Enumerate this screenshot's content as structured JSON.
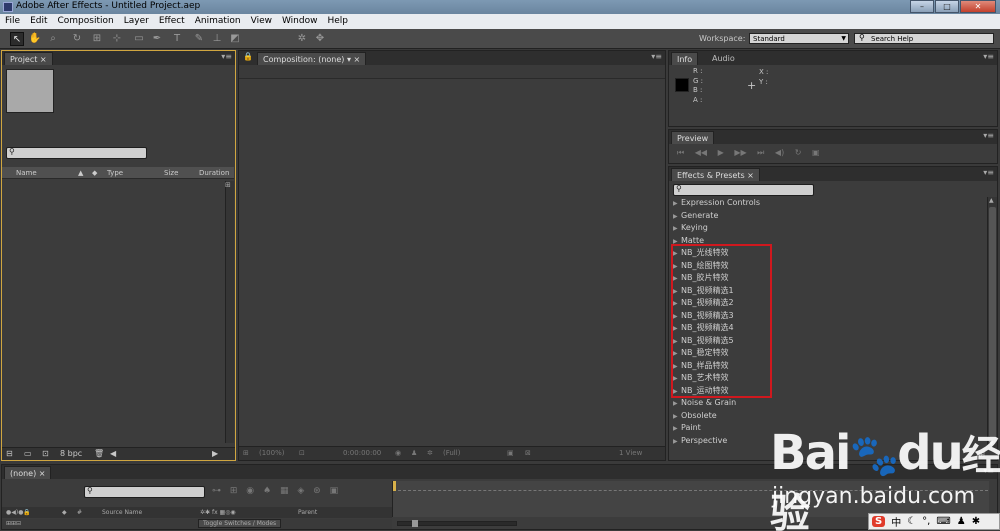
{
  "window": {
    "title": "Adobe After Effects - Untitled Project.aep",
    "min": "–",
    "max": "□",
    "close": "✕"
  },
  "menu": [
    "File",
    "Edit",
    "Composition",
    "Layer",
    "Effect",
    "Animation",
    "View",
    "Window",
    "Help"
  ],
  "toolbar": {
    "workspace_label": "Workspace:",
    "workspace_value": "Standard",
    "search_help_placeholder": "Search Help"
  },
  "project_panel": {
    "tab": "Project",
    "columns": [
      "Name",
      "Type",
      "Size",
      "Duration"
    ],
    "bit_depth": "8 bpc"
  },
  "composition_panel": {
    "tab": "Composition: (none)",
    "footer": {
      "zoom": "(100%)",
      "timecode": "0:00:00:00",
      "quality": "(Full)",
      "views": "1 View"
    }
  },
  "info_panel": {
    "tabs": [
      "Info",
      "Audio"
    ],
    "labels": [
      "R :",
      "G :",
      "B :",
      "A :"
    ],
    "xy_labels": [
      "X :",
      "Y :"
    ],
    "swatch_color": "#000000"
  },
  "preview_panel": {
    "tab": "Preview"
  },
  "effects_panel": {
    "tab": "Effects & Presets",
    "items": [
      "Expression Controls",
      "Generate",
      "Keying",
      "Matte",
      "NB_光线特效",
      "NB_绘图特效",
      "NB_胶片特效",
      "NB_视频精选1",
      "NB_视频精选2",
      "NB_视频精选3",
      "NB_视频精选4",
      "NB_视频精选5",
      "NB_稳定特效",
      "NB_样品特效",
      "NB_艺术特效",
      "NB_运动特效",
      "Noise & Grain",
      "Obsolete",
      "Paint",
      "Perspective"
    ],
    "highlight_color": "#d0181e"
  },
  "timeline_panel": {
    "tab": "(none)",
    "col_source_name": "Source Name",
    "col_parent": "Parent",
    "toggle_label": "Toggle Switches / Modes"
  },
  "watermark": {
    "brand": "Bai",
    "brand2": "du",
    "cn": "经验",
    "url": "jingyan.baidu.com"
  },
  "tray": {
    "s_icon": "S",
    "text": "中"
  }
}
